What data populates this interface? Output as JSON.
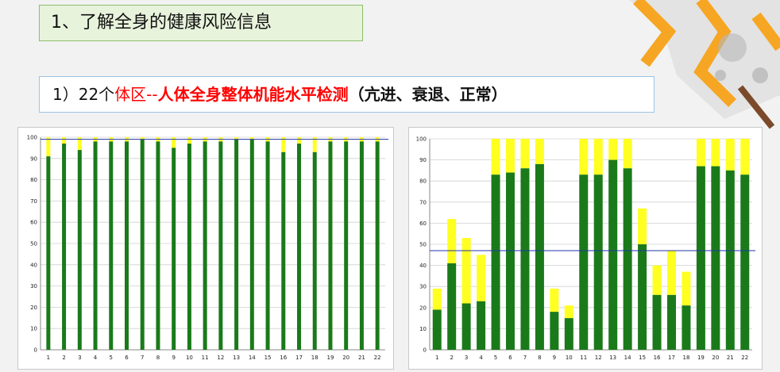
{
  "title": "1、了解全身的健康风险信息",
  "subtitle": {
    "prefix": "1）22个",
    "red_normal": "体区--",
    "red_bold": "人体全身整体机能水平检测",
    "suffix": "（亢进、衰退、正常）"
  },
  "colors": {
    "bar": "#1a7a1a",
    "cap": "#ffff22",
    "line": "#2233aa",
    "title_bg": "#e8f3dc",
    "accent": "#f6a623"
  },
  "chart_data": [
    {
      "type": "bar",
      "title": "",
      "categories": [
        "1",
        "2",
        "3",
        "4",
        "5",
        "6",
        "7",
        "8",
        "9",
        "10",
        "11",
        "12",
        "13",
        "14",
        "15",
        "16",
        "17",
        "18",
        "19",
        "20",
        "21",
        "22"
      ],
      "ylim": [
        0,
        100
      ],
      "yticks": [
        0,
        10,
        20,
        30,
        40,
        50,
        60,
        70,
        80,
        90,
        100
      ],
      "grid": true,
      "reference_line": 99,
      "bar_base": [
        91,
        97,
        94,
        98,
        98,
        98,
        99,
        98,
        95,
        97,
        98,
        98,
        99,
        99,
        98,
        93,
        97,
        93,
        98,
        98,
        98,
        98
      ],
      "bar_top": [
        100,
        100,
        100,
        100,
        100,
        100,
        100,
        100,
        100,
        100,
        100,
        100,
        100,
        100,
        100,
        100,
        100,
        100,
        100,
        100,
        100,
        100
      ]
    },
    {
      "type": "bar",
      "title": "",
      "categories": [
        "1",
        "2",
        "3",
        "4",
        "5",
        "6",
        "7",
        "8",
        "9",
        "10",
        "11",
        "12",
        "13",
        "14",
        "15",
        "16",
        "17",
        "18",
        "19",
        "20",
        "21",
        "22"
      ],
      "ylim": [
        0,
        100
      ],
      "yticks": [
        0,
        10,
        20,
        30,
        40,
        50,
        60,
        70,
        80,
        90,
        100
      ],
      "grid": true,
      "reference_line": 47,
      "bar_base": [
        19,
        41,
        22,
        23,
        83,
        84,
        86,
        88,
        18,
        15,
        83,
        83,
        90,
        86,
        50,
        26,
        26,
        21,
        87,
        87,
        85,
        83
      ],
      "bar_top": [
        29,
        62,
        53,
        45,
        100,
        100,
        100,
        100,
        29,
        21,
        100,
        100,
        100,
        100,
        67,
        40,
        47,
        37,
        100,
        100,
        100,
        100
      ]
    }
  ]
}
